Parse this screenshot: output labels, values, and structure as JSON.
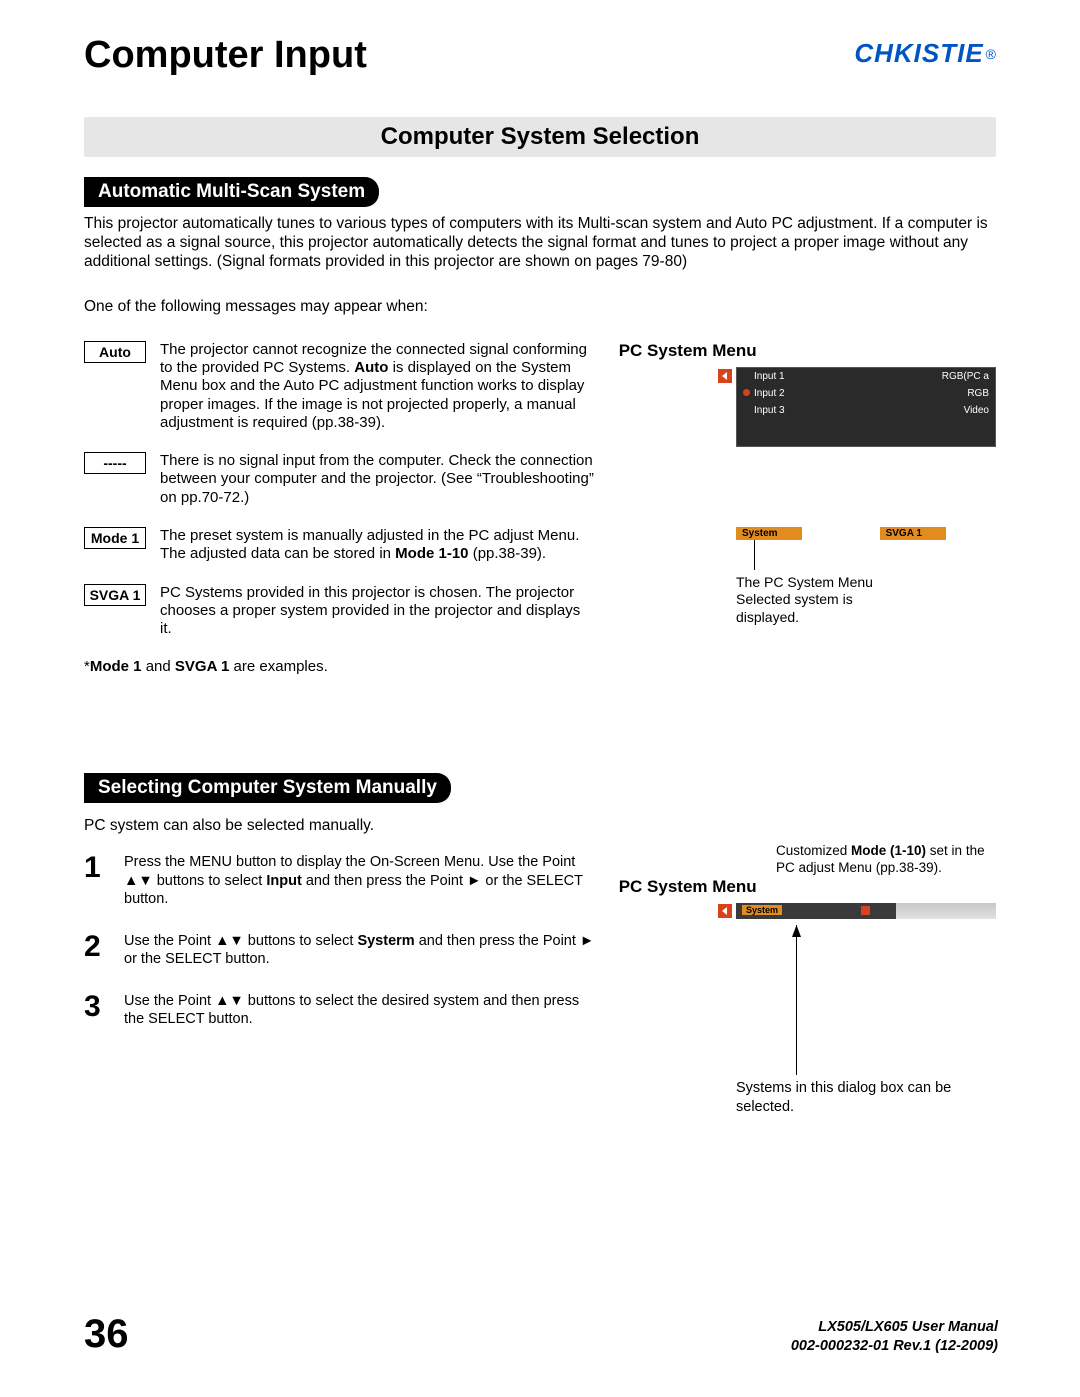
{
  "header": {
    "title": "Computer Input",
    "logo_text": "CHKISTIE"
  },
  "banner": "Computer System Selection",
  "section1": {
    "heading": "Automatic Multi-Scan System",
    "intro": "This projector automatically tunes to various types of computers with its Multi-scan system and Auto PC adjustment. If a computer is selected as a signal source, this projector automatically detects the signal format and tunes to project a proper image without any additional settings. (Signal formats provided in this projector are shown on pages 79-80)",
    "messages_intro": "One of the following messages may appear when:",
    "messages": [
      {
        "label": "Auto",
        "desc_pre": "The projector cannot recognize the connected signal conforming to the provided PC Systems. ",
        "desc_bold1": "Auto",
        "desc_post": " is displayed on the System Menu box and the Auto PC adjustment function works to display proper images. If the image is not projected properly, a manual adjustment is required (pp.38-39)."
      },
      {
        "label": "-----",
        "desc": "There is no signal input from the computer. Check the connection between your computer and the projector. (See “Troubleshooting” on pp.70-72.)"
      },
      {
        "label": "Mode 1",
        "desc_pre": "The preset system is manually adjusted in the PC adjust Menu. The adjusted data can be stored in ",
        "desc_bold1": "Mode 1-10",
        "desc_post": " (pp.38-39)."
      },
      {
        "label": "SVGA 1",
        "desc": "PC Systems provided in this projector is chosen.  The projector chooses a proper system provided in the projector and displays it."
      }
    ],
    "examples_note_pre": "*",
    "examples_note_b1": "Mode 1",
    "examples_note_mid": " and ",
    "examples_note_b2": "SVGA 1",
    "examples_note_post": " are examples.",
    "right": {
      "heading": "PC System Menu",
      "inputs": [
        {
          "left": "Input 1",
          "right": "RGB(PC a",
          "dot": false
        },
        {
          "left": "Input 2",
          "right": "RGB",
          "dot": true
        },
        {
          "left": "Input 3",
          "right": "Video",
          "dot": false
        }
      ],
      "bars": [
        "System",
        "SVGA 1"
      ],
      "callout": "The PC System Menu Selected system is displayed."
    }
  },
  "section2": {
    "heading": "Selecting Computer System Manually",
    "intro": "PC system can also be selected manually.",
    "steps": [
      {
        "n": "1",
        "pre": "Press the MENU button to display the On-Screen Menu. Use the Point ▲▼ buttons to select ",
        "b1": "Input",
        "post": " and then press the Point ► or the SELECT button."
      },
      {
        "n": "2",
        "pre": "Use the Point ▲▼ buttons to select ",
        "b1": "Systerm",
        "post": " and then press the Point ► or the SELECT button."
      },
      {
        "n": "3",
        "text": "Use the Point ▲▼ buttons to select the desired system and then press the SELECT button."
      }
    ],
    "right": {
      "customized_pre": "Customized ",
      "customized_b": "Mode (1-10)",
      "customized_post": " set in the PC adjust Menu (pp.38-39).",
      "heading": "PC System Menu",
      "bar": "System",
      "callout": "Systems in this dialog box can be selected."
    }
  },
  "footer": {
    "page": "36",
    "line1": "LX505/LX605 User Manual",
    "line2": "002-000232-01 Rev.1 (12-2009)"
  }
}
